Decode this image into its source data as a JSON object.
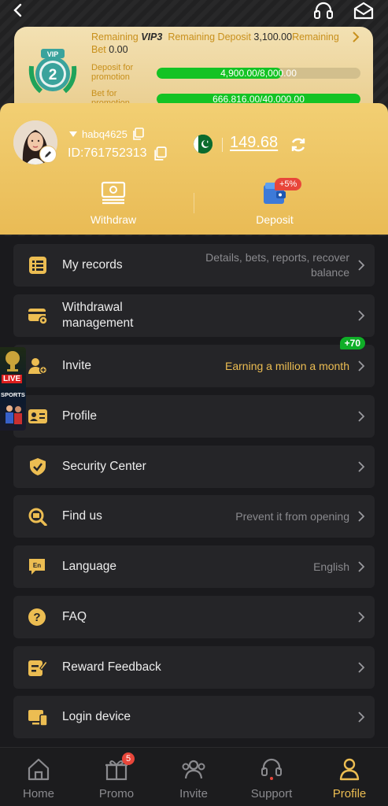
{
  "colors": {
    "accent_gold": "#ecbd52",
    "progress_green": "#14c324",
    "badge_red": "#e8463a",
    "badge_green": "#0fae27"
  },
  "vip": {
    "level": "2",
    "badge_text": "VIP",
    "remaining_label": "Remaining",
    "next_level": "VIP3",
    "remaining_deposit_label": "Remaining Deposit",
    "remaining_deposit": "3,100.00",
    "remaining_bet_label": "Remaining Bet",
    "remaining_label_2": "Remaining",
    "bet_label": "Bet",
    "remaining_bet": "0.00",
    "deposit_promo_label": "Deposit for promotion",
    "deposit_progress": "4,900.00/8,000.00",
    "deposit_fraction": 0.6125,
    "bet_promo_label": "Bet for promotion",
    "bet_progress": "666.816.00/40.000.00",
    "bet_fraction": 1.0
  },
  "account": {
    "username": "habq4625",
    "id": "ID:761752313",
    "balance": "149.68"
  },
  "actions": {
    "withdraw": "Withdraw",
    "deposit": "Deposit",
    "deposit_bonus": "+5%"
  },
  "menu": {
    "records": {
      "label": "My records",
      "hint": "Details, bets, reports, recover balance"
    },
    "withdrawal": {
      "label": "Withdrawal management"
    },
    "invite": {
      "label": "Invite",
      "hint": "Earning a million a month",
      "badge": "+70"
    },
    "profile": {
      "label": "Profile"
    },
    "security": {
      "label": "Security Center"
    },
    "findus": {
      "label": "Find us",
      "hint": "Prevent it from opening"
    },
    "language": {
      "label": "Language",
      "hint": "English"
    },
    "faq": {
      "label": "FAQ"
    },
    "feedback": {
      "label": "Reward Feedback"
    },
    "login_device": {
      "label": "Login device"
    }
  },
  "ad": {
    "live": "LIVE",
    "sports": "SPORTS"
  },
  "tabs": {
    "home": "Home",
    "promo": "Promo",
    "promo_badge": "5",
    "invite": "Invite",
    "support": "Support",
    "profile": "Profile"
  }
}
